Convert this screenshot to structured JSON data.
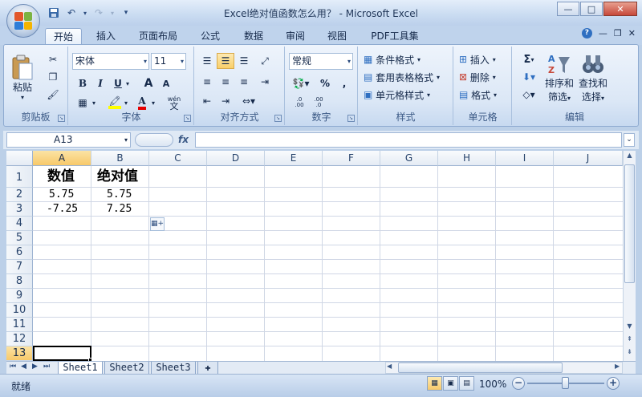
{
  "window": {
    "title": "Excel绝对值函数怎么用？ - Microsoft Excel"
  },
  "quick_access": {
    "icons": [
      "save-icon",
      "undo-icon",
      "redo-icon",
      "customize-icon"
    ]
  },
  "tabs": [
    {
      "label": "开始",
      "active": true
    },
    {
      "label": "插入"
    },
    {
      "label": "页面布局"
    },
    {
      "label": "公式"
    },
    {
      "label": "数据"
    },
    {
      "label": "审阅"
    },
    {
      "label": "视图"
    },
    {
      "label": "PDF工具集"
    }
  ],
  "ribbon": {
    "clipboard": {
      "paste": "粘贴",
      "group": "剪贴板"
    },
    "font": {
      "name": "宋体",
      "size": "11",
      "group": "字体",
      "bold": "B",
      "italic": "I",
      "underline": "U",
      "grow": "A",
      "shrink": "A",
      "phonetic_top": "wén",
      "phonetic_bottom": "文"
    },
    "alignment": {
      "group": "对齐方式"
    },
    "number": {
      "format": "常规",
      "group": "数字",
      "percent": "%",
      "comma": ",",
      "inc_decimal": ".0\n.00",
      "dec_decimal": ".00\n.0"
    },
    "styles": {
      "conditional": "条件格式",
      "table": "套用表格格式",
      "cell": "单元格样式",
      "group": "样式"
    },
    "cells": {
      "insert": "插入",
      "delete": "删除",
      "format": "格式",
      "group": "单元格"
    },
    "editing": {
      "sigma": "Σ",
      "sort": "排序和",
      "sort2": "筛选",
      "find": "查找和",
      "find2": "选择",
      "group": "编辑"
    }
  },
  "formula_bar": {
    "name_box": "A13",
    "fx": "fx",
    "value": ""
  },
  "columns": [
    "A",
    "B",
    "C",
    "D",
    "E",
    "F",
    "G",
    "H",
    "I",
    "J"
  ],
  "rows": [
    "1",
    "2",
    "3",
    "4",
    "5",
    "6",
    "7",
    "8",
    "9",
    "10",
    "11",
    "12",
    "13"
  ],
  "cells": {
    "a1": "数值",
    "b1": "绝对值",
    "a2": "5.75",
    "b2": "5.75",
    "a3": "-7.25",
    "b3": "7.25"
  },
  "sheets": [
    "Sheet1",
    "Sheet2",
    "Sheet3"
  ],
  "status": {
    "text": "就绪",
    "zoom": "100%",
    "zoom_level": 1.0
  }
}
